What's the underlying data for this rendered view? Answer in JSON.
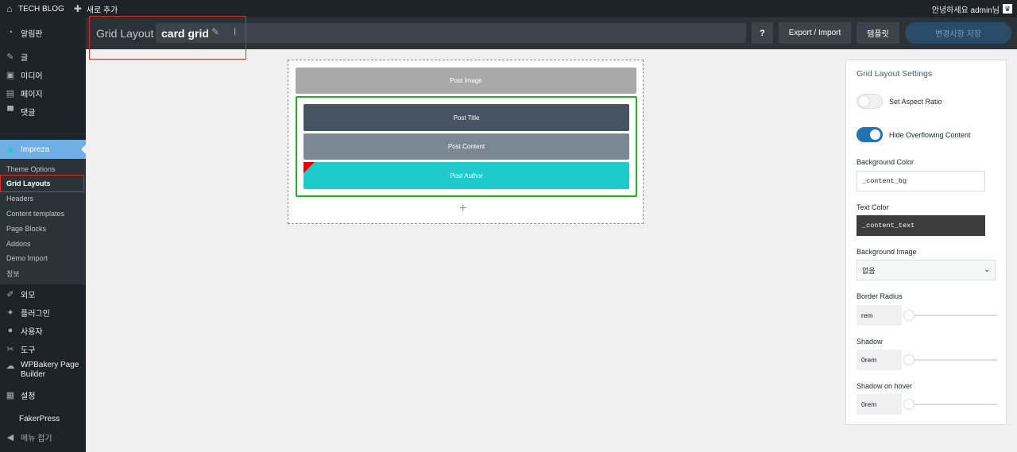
{
  "adminbar": {
    "site_name": "TECH BLOG",
    "new_label": "새로 추가",
    "greeting": "안녕하세요 admin님"
  },
  "sidebar": {
    "items": [
      {
        "label": "알림판",
        "icon": "dashboard-icon"
      },
      {
        "label": "글",
        "icon": "pin-icon"
      },
      {
        "label": "미디어",
        "icon": "media-icon"
      },
      {
        "label": "페이지",
        "icon": "page-icon"
      },
      {
        "label": "댓글",
        "icon": "comment-icon"
      },
      {
        "label": "Impreza",
        "icon": "impreza-icon"
      },
      {
        "label": "외모",
        "icon": "brush-icon"
      },
      {
        "label": "플러그인",
        "icon": "plugin-icon"
      },
      {
        "label": "사용자",
        "icon": "user-icon"
      },
      {
        "label": "도구",
        "icon": "wrench-icon"
      },
      {
        "label": "WPBakery Page",
        "label2": "Builder",
        "icon": "wpbakery-icon"
      },
      {
        "label": "설정",
        "icon": "settings-icon"
      },
      {
        "label": "FakerPress",
        "icon": ""
      },
      {
        "label": "메뉴 접기",
        "icon": "collapse-icon"
      }
    ],
    "submenu": [
      "Theme Options",
      "Grid Layouts",
      "Headers",
      "Content templates",
      "Page Blocks",
      "Addons",
      "Demo Import",
      "정보"
    ]
  },
  "header": {
    "prefix": "Grid Layout",
    "title": "card grid",
    "help_label": "?",
    "export_label": "Export / Import",
    "templates_label": "템플릿",
    "save_label": "변경사항 저장"
  },
  "canvas": {
    "post_image": "Post Image",
    "post_title": "Post Title",
    "post_content": "Post Content",
    "post_author": "Post Author",
    "add_label": "+"
  },
  "settings": {
    "title": "Grid Layout Settings",
    "set_aspect_ratio": {
      "label": "Set Aspect Ratio",
      "on": false
    },
    "hide_overflowing": {
      "label": "Hide Overflowing Content",
      "on": true
    },
    "background_color": {
      "label": "Background Color",
      "value": "_content_bg"
    },
    "text_color": {
      "label": "Text Color",
      "value": "_content_text"
    },
    "background_image": {
      "label": "Background Image",
      "value": "없음"
    },
    "border_radius": {
      "label": "Border Radius",
      "value": "rem",
      "level": 0
    },
    "shadow": {
      "label": "Shadow",
      "value": "0rem",
      "level": 0
    },
    "shadow_hover": {
      "label": "Shadow on hover",
      "value": "0rem",
      "level": 0
    }
  },
  "colors": {
    "admin_dark": "#1d2327",
    "accent_blue": "#72aee6",
    "highlight_red": "#e02b27",
    "container_green": "#1fb11f",
    "post_image_bg": "#a9a9a9",
    "post_title_bg": "#475360",
    "post_content_bg": "#7c8794",
    "post_author_bg": "#1ecbcb"
  }
}
